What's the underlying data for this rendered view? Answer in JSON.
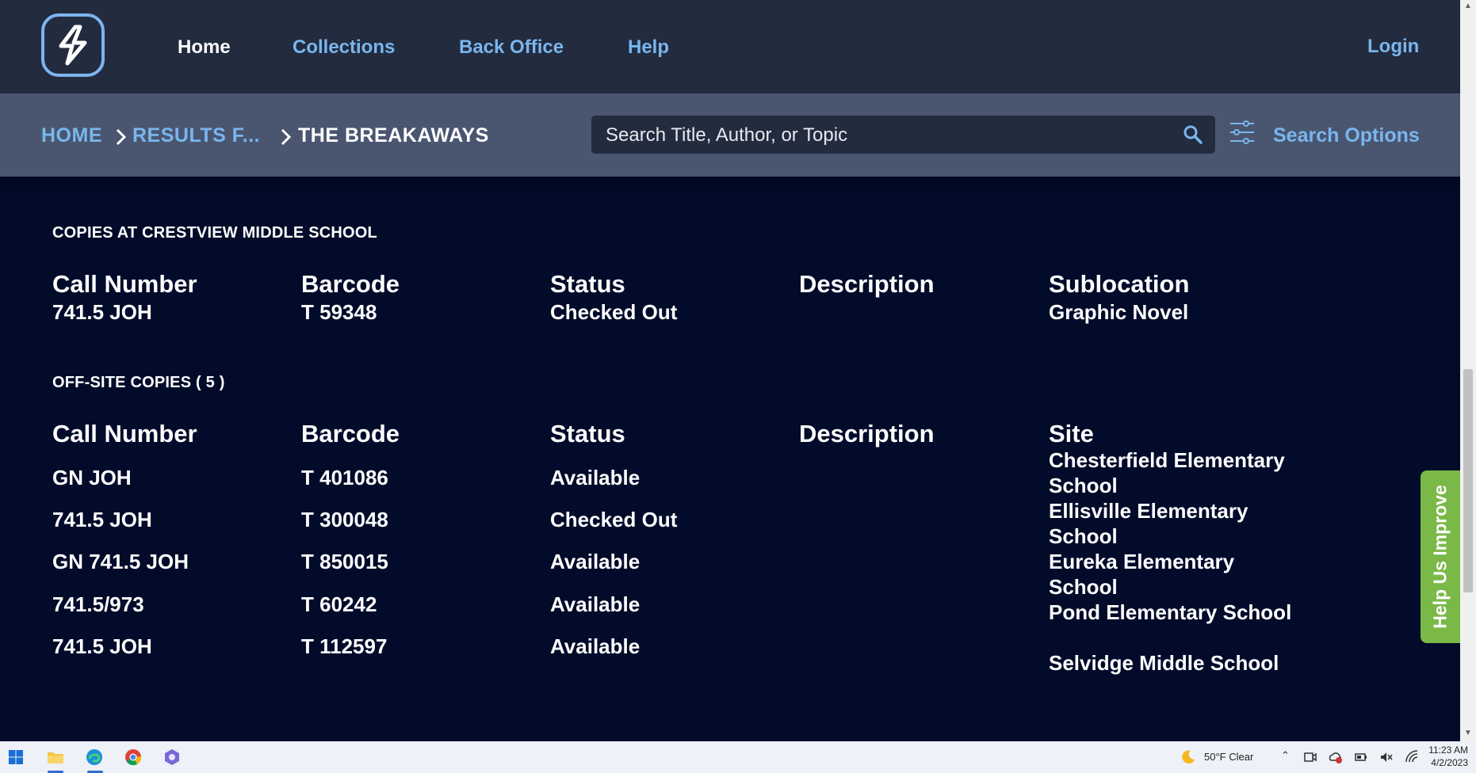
{
  "nav": {
    "links": [
      "Home",
      "Collections",
      "Back Office",
      "Help"
    ],
    "login": "Login"
  },
  "breadcrumb": {
    "home": "HOME",
    "results": "RESULTS F...",
    "current": "THE BREAKAWAYS"
  },
  "search": {
    "placeholder": "Search Title, Author, or Topic",
    "options_label": "Search Options"
  },
  "local_copies": {
    "title": "COPIES AT CRESTVIEW MIDDLE SCHOOL",
    "headers": [
      "Call Number",
      "Barcode",
      "Status",
      "Description",
      "Sublocation"
    ],
    "rows": [
      {
        "call_number": "741.5 JOH",
        "barcode": "T 59348",
        "status": "Checked Out",
        "description": "",
        "sublocation": "Graphic Novel"
      }
    ]
  },
  "offsite_copies": {
    "title": "OFF-SITE COPIES ( 5 )",
    "headers": [
      "Call Number",
      "Barcode",
      "Status",
      "Description",
      "Site"
    ],
    "rows": [
      {
        "call_number": "GN JOH",
        "barcode": "T 401086",
        "status": "Available"
      },
      {
        "call_number": "741.5 JOH",
        "barcode": "T 300048",
        "status": "Checked Out"
      },
      {
        "call_number": "GN 741.5 JOH",
        "barcode": "T 850015",
        "status": "Available"
      },
      {
        "call_number": "741.5/973",
        "barcode": "T 60242",
        "status": "Available"
      },
      {
        "call_number": "741.5 JOH",
        "barcode": "T 112597",
        "status": "Available"
      }
    ],
    "sites": [
      "Chesterfield Elementary School",
      "Ellisville Elementary School",
      "Eureka Elementary School",
      "Pond Elementary School",
      "Selvidge Middle School"
    ]
  },
  "feedback": {
    "label": "Help Us Improve"
  },
  "taskbar": {
    "weather": "50°F  Clear",
    "time": "11:23 AM",
    "date": "4/2/2023",
    "icons": [
      "windows-start-icon",
      "file-explorer-icon",
      "edge-icon",
      "chrome-icon",
      "copilot-icon"
    ]
  },
  "colors": {
    "nav_bg": "#232b3f",
    "subbar_bg": "#4a5670",
    "page_bg": "#020b2a",
    "link": "#79b6ee",
    "feedback": "#7ab848"
  }
}
